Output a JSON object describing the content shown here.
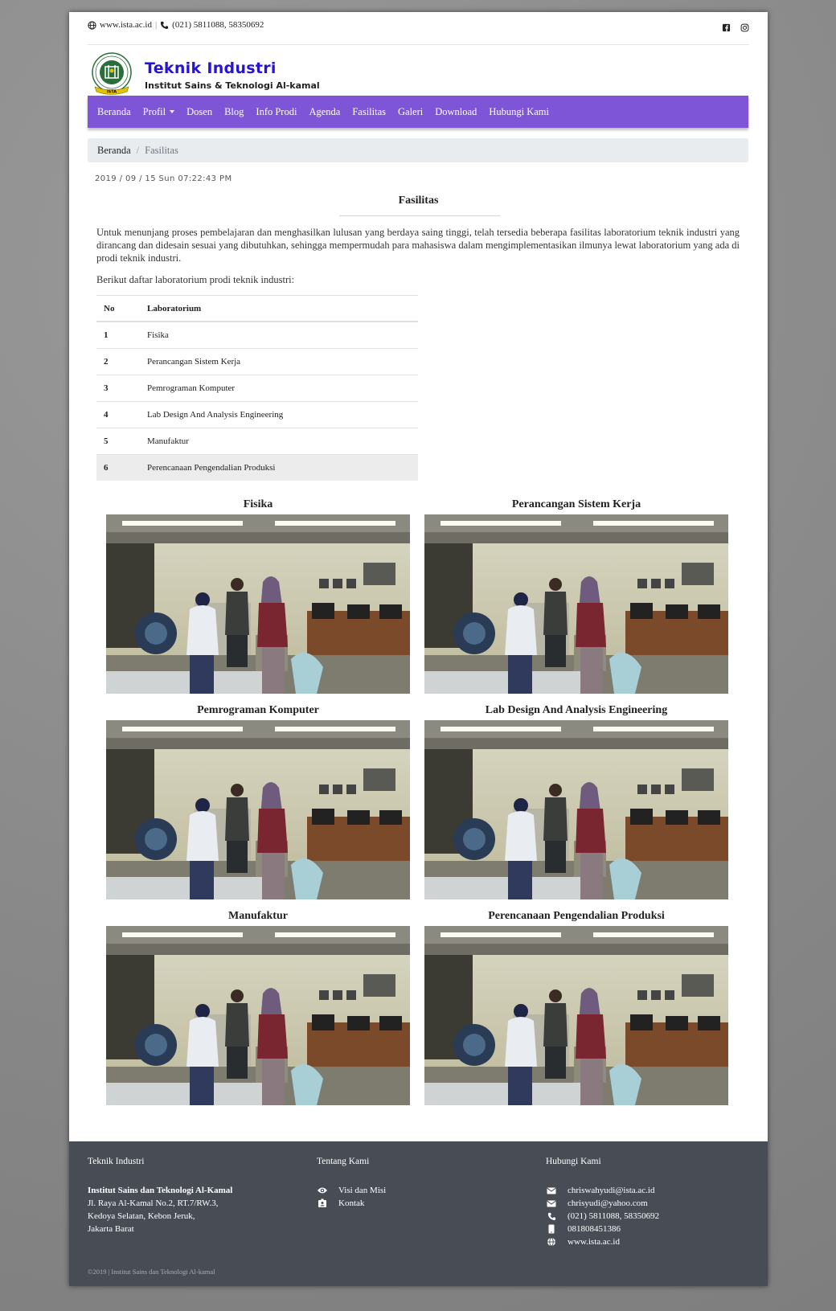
{
  "topbar": {
    "website": "www.ista.ac.id",
    "separator": "|",
    "phone": "(021) 5811088, 58350692",
    "social_icons": [
      "facebook-icon",
      "instagram-icon"
    ]
  },
  "brand": {
    "title": "Teknik Industri",
    "subtitle": "Institut Sains & Teknologi Al-kamal",
    "logo_ring_text": "INSTITUT SAINS DAN TEKNOLOGI AL-KAMAL",
    "logo_banner_text": "ISTA"
  },
  "nav": {
    "items": [
      {
        "label": "Beranda"
      },
      {
        "label": "Profil",
        "dropdown": true
      },
      {
        "label": "Dosen"
      },
      {
        "label": "Blog"
      },
      {
        "label": "Info Prodi"
      },
      {
        "label": "Agenda"
      },
      {
        "label": "Fasilitas"
      },
      {
        "label": "Galeri"
      },
      {
        "label": "Download"
      },
      {
        "label": "Hubungi Kami"
      }
    ]
  },
  "breadcrumb": {
    "home": "Beranda",
    "separator": "/",
    "current": "Fasilitas"
  },
  "datetime": "2019 / 09 / 15 Sun 07:22:43 PM",
  "content": {
    "title": "Fasilitas",
    "intro": "Untuk menunjang proses pembelajaran dan menghasilkan lulusan yang berdaya saing tinggi, telah tersedia beberapa fasilitas laboratorium teknik industri yang dirancang dan didesain sesuai yang dibutuhkan, sehingga mempermudah para mahasiswa dalam mengimplementasikan ilmunya lewat laboratorium yang ada di prodi teknik industri.",
    "intro2": "Berikut daftar laboratorium prodi teknik industri:"
  },
  "table": {
    "headers": [
      "No",
      "Laboratorium"
    ],
    "rows": [
      {
        "no": "1",
        "name": "Fisika"
      },
      {
        "no": "2",
        "name": "Perancangan Sistem Kerja"
      },
      {
        "no": "3",
        "name": "Pemrograman Komputer"
      },
      {
        "no": "4",
        "name": "Lab Design And Analysis Engineering"
      },
      {
        "no": "5",
        "name": "Manufaktur"
      },
      {
        "no": "6",
        "name": "Perencanaan Pengendalian Produksi"
      }
    ]
  },
  "gallery": [
    {
      "title": "Fisika"
    },
    {
      "title": "Perancangan Sistem Kerja"
    },
    {
      "title": "Pemrograman Komputer"
    },
    {
      "title": "Lab Design And Analysis Engineering"
    },
    {
      "title": "Manufaktur"
    },
    {
      "title": "Perencanaan Pengendalian Produksi"
    }
  ],
  "footer": {
    "col1": {
      "heading": "Teknik Industri",
      "address": [
        "Institut Sains dan Teknologi Al-Kamal",
        "Jl. Raya Al-Kamal No.2, RT.7/RW.3,",
        "Kedoya Selatan, Kebon Jeruk,",
        "Jakarta Barat"
      ]
    },
    "col2": {
      "heading": "Tentang Kami",
      "links": [
        {
          "icon": "eye-icon",
          "label": "Visi dan Misi"
        },
        {
          "icon": "contact-card-icon",
          "label": "Kontak"
        }
      ]
    },
    "col3": {
      "heading": "Hubungi Kami",
      "items": [
        {
          "icon": "envelope-icon",
          "label": "chriswahyudi@ista.ac.id"
        },
        {
          "icon": "envelope-icon",
          "label": "chrisyudi@yahoo.com"
        },
        {
          "icon": "phone-icon",
          "label": "(021) 5811088, 58350692"
        },
        {
          "icon": "mobile-icon",
          "label": "081808451386"
        },
        {
          "icon": "globe-icon",
          "label": "www.ista.ac.id"
        }
      ]
    },
    "copyright": "©2019 | Institut Sains dan Teknologi Al-kamal"
  },
  "colors": {
    "navbar": "#7e55d6",
    "brand_title": "#2613d6",
    "footer": "#484c55",
    "breadcrumb_bg": "#e9ecef"
  }
}
